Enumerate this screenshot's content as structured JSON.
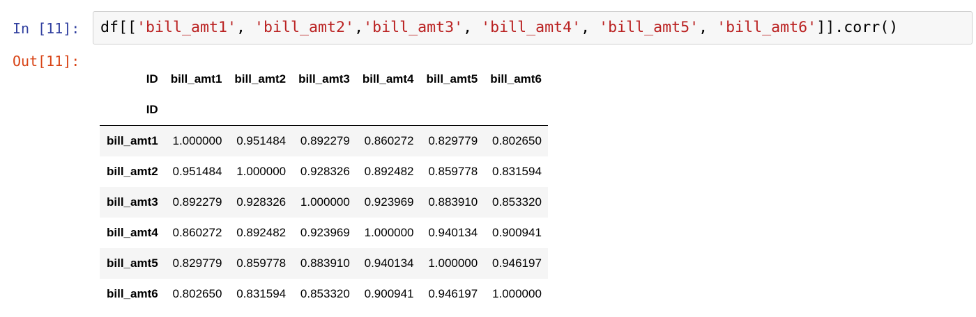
{
  "input_cell": {
    "prompt": "In [11]:",
    "code_tokens": [
      {
        "text": "df[[",
        "kind": "plain"
      },
      {
        "text": "'bill_amt1'",
        "kind": "str"
      },
      {
        "text": ", ",
        "kind": "plain"
      },
      {
        "text": "'bill_amt2'",
        "kind": "str"
      },
      {
        "text": ",",
        "kind": "plain"
      },
      {
        "text": "'bill_amt3'",
        "kind": "str"
      },
      {
        "text": ", ",
        "kind": "plain"
      },
      {
        "text": "'bill_amt4'",
        "kind": "str"
      },
      {
        "text": ", ",
        "kind": "plain"
      },
      {
        "text": "'bill_amt5'",
        "kind": "str"
      },
      {
        "text": ", ",
        "kind": "plain"
      },
      {
        "text": "'bill_amt6'",
        "kind": "str"
      },
      {
        "text": "]].corr()",
        "kind": "plain"
      }
    ]
  },
  "output_cell": {
    "prompt": "Out[11]:",
    "table": {
      "corner_label": "ID",
      "index_name": "ID",
      "columns": [
        "bill_amt1",
        "bill_amt2",
        "bill_amt3",
        "bill_amt4",
        "bill_amt5",
        "bill_amt6"
      ],
      "rows": [
        {
          "label": "bill_amt1",
          "values": [
            "1.000000",
            "0.951484",
            "0.892279",
            "0.860272",
            "0.829779",
            "0.802650"
          ]
        },
        {
          "label": "bill_amt2",
          "values": [
            "0.951484",
            "1.000000",
            "0.928326",
            "0.892482",
            "0.859778",
            "0.831594"
          ]
        },
        {
          "label": "bill_amt3",
          "values": [
            "0.892279",
            "0.928326",
            "1.000000",
            "0.923969",
            "0.883910",
            "0.853320"
          ]
        },
        {
          "label": "bill_amt4",
          "values": [
            "0.860272",
            "0.892482",
            "0.923969",
            "1.000000",
            "0.940134",
            "0.900941"
          ]
        },
        {
          "label": "bill_amt5",
          "values": [
            "0.829779",
            "0.859778",
            "0.883910",
            "0.940134",
            "1.000000",
            "0.946197"
          ]
        },
        {
          "label": "bill_amt6",
          "values": [
            "0.802650",
            "0.831594",
            "0.853320",
            "0.900941",
            "0.946197",
            "1.000000"
          ]
        }
      ]
    }
  },
  "colors": {
    "in_prompt": "#303f9f",
    "out_prompt": "#d84315",
    "string_literal": "#ba2121",
    "cell_background": "#f7f7f7",
    "cell_border": "#cfcfcf",
    "row_stripe": "#f5f5f5"
  }
}
